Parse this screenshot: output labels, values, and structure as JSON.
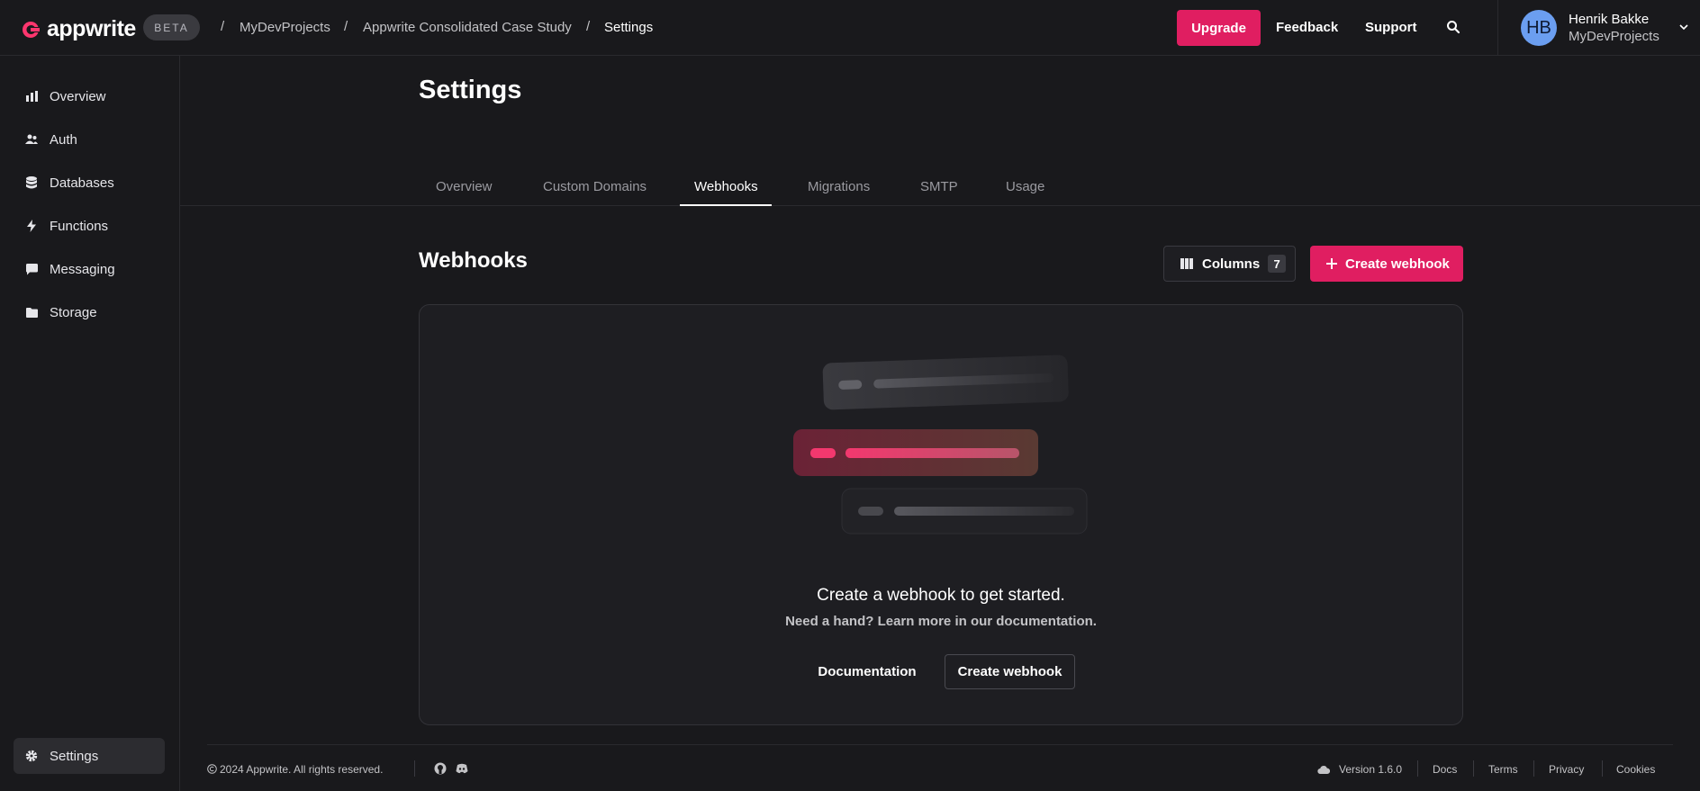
{
  "header": {
    "logo_text": "appwrite",
    "badge": "BETA",
    "breadcrumbs": [
      "MyDevProjects",
      "Appwrite Consolidated Case Study",
      "Settings"
    ],
    "upgrade_label": "Upgrade",
    "feedback_label": "Feedback",
    "support_label": "Support",
    "user": {
      "initials": "HB",
      "name": "Henrik Bakke",
      "org": "MyDevProjects"
    }
  },
  "sidebar": {
    "items": [
      {
        "label": "Overview",
        "icon": "chart-icon"
      },
      {
        "label": "Auth",
        "icon": "users-icon"
      },
      {
        "label": "Databases",
        "icon": "database-icon"
      },
      {
        "label": "Functions",
        "icon": "lightning-icon"
      },
      {
        "label": "Messaging",
        "icon": "chat-icon"
      },
      {
        "label": "Storage",
        "icon": "folder-icon"
      }
    ],
    "settings_label": "Settings"
  },
  "page": {
    "title": "Settings",
    "tabs": [
      "Overview",
      "Custom Domains",
      "Webhooks",
      "Migrations",
      "SMTP",
      "Usage"
    ],
    "active_tab": "Webhooks"
  },
  "webhooks": {
    "title": "Webhooks",
    "columns_label": "Columns",
    "columns_count": "7",
    "create_label": "Create webhook",
    "empty_title": "Create a webhook to get started.",
    "empty_sub": "Need a hand? Learn more in our documentation.",
    "documentation_label": "Documentation",
    "create_label_secondary": "Create webhook"
  },
  "footer": {
    "copyright": "2024 Appwrite. All rights reserved.",
    "version": "Version 1.6.0",
    "links": [
      "Docs",
      "Terms",
      "Privacy",
      "Cookies"
    ]
  },
  "colors": {
    "accent": "#e01e61",
    "background": "#19191c"
  }
}
